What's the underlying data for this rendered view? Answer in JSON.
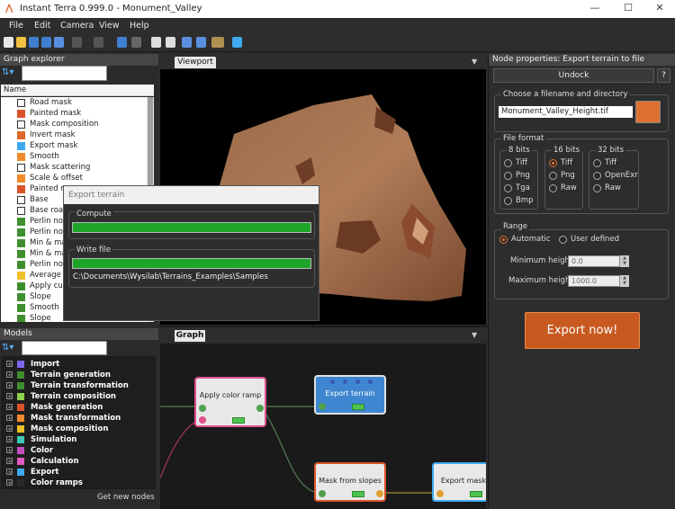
{
  "window": {
    "title": "Instant Terra 0.999.0 - Monument_Valley",
    "minimize": "—",
    "maximize": "☐",
    "close": "✕"
  },
  "menu": [
    "File",
    "Edit",
    "Camera",
    "View",
    "Help"
  ],
  "graph_explorer": {
    "title": "Graph explorer",
    "column_header": "Name",
    "items": [
      {
        "label": "Road mask",
        "color": "#ffffff"
      },
      {
        "label": "Painted mask",
        "color": "#d9532b"
      },
      {
        "label": "Mask composition",
        "color": "#ffffff"
      },
      {
        "label": "Invert mask",
        "color": "#e0672a"
      },
      {
        "label": "Export mask",
        "color": "#3ea8f0"
      },
      {
        "label": "Smooth",
        "color": "#f08a2a"
      },
      {
        "label": "Mask scattering",
        "color": "#ffffff"
      },
      {
        "label": "Scale & offset",
        "color": "#f08a2a"
      },
      {
        "label": "Painted m",
        "color": "#d9532b"
      },
      {
        "label": "Base",
        "color": "#ffffff"
      },
      {
        "label": "Base road",
        "color": "#ffffff"
      },
      {
        "label": "Perlin nois",
        "color": "#3f8f2f"
      },
      {
        "label": "Perlin nois",
        "color": "#3f8f2f"
      },
      {
        "label": "Min & max",
        "color": "#3f8f2f"
      },
      {
        "label": "Min & max",
        "color": "#3f8f2f"
      },
      {
        "label": "Perlin nois",
        "color": "#3f8f2f"
      },
      {
        "label": "Average",
        "color": "#f0c02a"
      },
      {
        "label": "Apply curv",
        "color": "#3f8f2f"
      },
      {
        "label": "Slope",
        "color": "#3f8f2f"
      },
      {
        "label": "Smooth",
        "color": "#3f8f2f"
      },
      {
        "label": "Slope",
        "color": "#3f8f2f"
      }
    ]
  },
  "models": {
    "title": "Models",
    "items": [
      {
        "label": "Import",
        "color": "#7b68ee"
      },
      {
        "label": "Terrain generation",
        "color": "#3f8f2f"
      },
      {
        "label": "Terrain transformation",
        "color": "#3f8f2f"
      },
      {
        "label": "Terrain composition",
        "color": "#8fd14f"
      },
      {
        "label": "Mask generation",
        "color": "#d9532b"
      },
      {
        "label": "Mask transformation",
        "color": "#f08a2a"
      },
      {
        "label": "Mask composition",
        "color": "#f0c02a"
      },
      {
        "label": "Simulation",
        "color": "#3cc8b4"
      },
      {
        "label": "Color",
        "color": "#c050c0"
      },
      {
        "label": "Calculation",
        "color": "#e05cc0"
      },
      {
        "label": "Export",
        "color": "#3ea8f0"
      },
      {
        "label": "Color ramps",
        "color": "#2a2a2a"
      }
    ],
    "get_new_nodes": "Get new nodes"
  },
  "viewport": {
    "tab": "Viewport"
  },
  "graph": {
    "tab": "Graph",
    "nodes": {
      "apply_color_ramp": "Apply color ramp",
      "export_terrain": "Export terrain",
      "mask_from_slopes": "Mask from slopes",
      "export_mask": "Export mask"
    }
  },
  "export_dialog": {
    "title": "Export terrain",
    "compute_label": "Compute",
    "compute_progress": 1.0,
    "write_label": "Write file",
    "write_progress": 1.0,
    "path": "C:\\Documents\\Wysilab\\Terrains_Examples\\Samples"
  },
  "node_properties": {
    "title": "Node properties: Export terrain to file",
    "undock": "Undock",
    "help": "?",
    "filename_group": "Choose a filename and directory",
    "filename": "Monument_Valley_Height.tif",
    "file_format_group": "File format",
    "bits8": {
      "title": "8 bits",
      "options": [
        "Tiff",
        "Png",
        "Tga",
        "Bmp"
      ]
    },
    "bits16": {
      "title": "16 bits",
      "options": [
        "Tiff",
        "Png",
        "Raw"
      ],
      "selected": "Tiff"
    },
    "bits32": {
      "title": "32 bits",
      "options": [
        "Tiff",
        "OpenExr",
        "Raw"
      ]
    },
    "range_group": "Range",
    "range_automatic": "Automatic",
    "range_user": "User defined",
    "min_label": "Minimum heigh",
    "min_value": "0.0",
    "max_label": "Maximum  height",
    "max_value": "1000.0",
    "export_button": "Export now!"
  },
  "colors": {
    "accent": "#e07030",
    "export_button": "#c85a20",
    "progress": "#1da52a",
    "node_pink": "#e0508c",
    "node_blue": "#3ea8f0",
    "node_orange": "#d9532b"
  }
}
